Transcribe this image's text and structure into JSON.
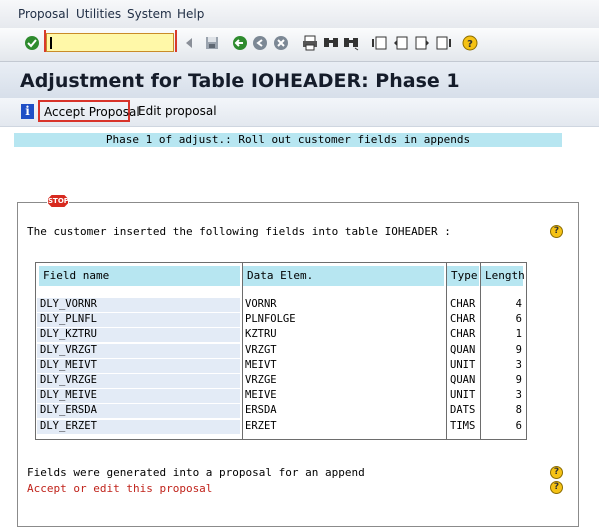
{
  "menu": {
    "items": [
      "Proposal",
      "Utilities",
      "System",
      "Help"
    ]
  },
  "toolbar": {
    "icons": [
      "enter-icon",
      "save-icon",
      "back-icon",
      "exit-icon",
      "cancel-icon",
      "print-icon",
      "find-icon",
      "find-next-icon",
      "first-page-icon",
      "previous-page-icon",
      "next-page-icon",
      "last-page-icon",
      "help-icon"
    ]
  },
  "title": "Adjustment for Table IOHEADER: Phase 1",
  "app_toolbar": {
    "accept_label": "Accept Proposal",
    "edit_label": "Edit proposal"
  },
  "phase_banner": "Phase 1 of adjust.: Roll out customer fields in appends",
  "stop_label": "STOP",
  "message": {
    "intro": "The customer inserted the following fields into table IOHEADER :",
    "footer": "Fields were generated into a proposal for an append",
    "action": "Accept or edit this proposal"
  },
  "table": {
    "headers": {
      "field_name": "Field name",
      "data_elem": "Data Elem.",
      "type": "Type",
      "length": "Length"
    },
    "rows": [
      {
        "field": "DLY_VORNR",
        "elem": "VORNR",
        "type": "CHAR",
        "len": "4"
      },
      {
        "field": "DLY_PLNFL",
        "elem": "PLNFOLGE",
        "type": "CHAR",
        "len": "6"
      },
      {
        "field": "DLY_KZTRU",
        "elem": "KZTRU",
        "type": "CHAR",
        "len": "1"
      },
      {
        "field": "DLY_VRZGT",
        "elem": "VRZGT",
        "type": "QUAN",
        "len": "9"
      },
      {
        "field": "DLY_MEIVT",
        "elem": "MEIVT",
        "type": "UNIT",
        "len": "3"
      },
      {
        "field": "DLY_VRZGE",
        "elem": "VRZGE",
        "type": "QUAN",
        "len": "9"
      },
      {
        "field": "DLY_MEIVE",
        "elem": "MEIVE",
        "type": "UNIT",
        "len": "3"
      },
      {
        "field": "DLY_ERSDA",
        "elem": "ERSDA",
        "type": "DATS",
        "len": "8"
      },
      {
        "field": "DLY_ERZET",
        "elem": "ERZET",
        "type": "TIMS",
        "len": "6"
      }
    ]
  },
  "colors": {
    "banner": "#b7e6f1",
    "action_text": "#c0231b",
    "highlight_border": "#d8342b"
  }
}
